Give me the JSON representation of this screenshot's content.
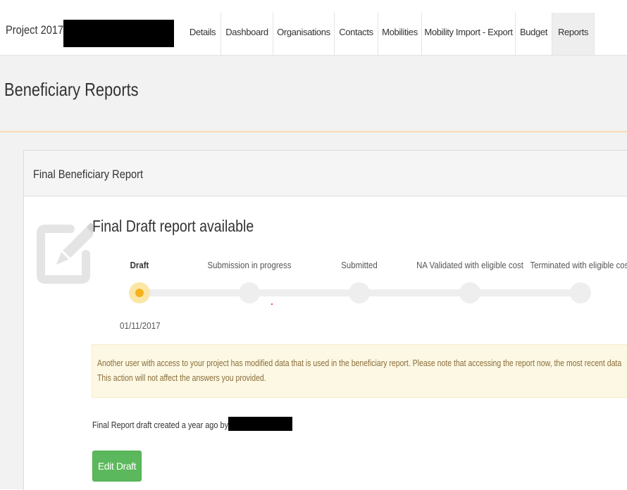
{
  "nav": {
    "project_title": "Project 2017",
    "tabs": [
      {
        "label": "Details"
      },
      {
        "label": "Dashboard"
      },
      {
        "label": "Organisations"
      },
      {
        "label": "Contacts"
      },
      {
        "label": "Mobilities"
      },
      {
        "label": "Mobility Import - Export"
      },
      {
        "label": "Budget"
      },
      {
        "label": "Reports",
        "active": true
      }
    ]
  },
  "page": {
    "title": "Beneficiary Reports"
  },
  "panel": {
    "title": "Final Beneficiary Report",
    "icon": "pencil-square-icon",
    "status_title": "Final Draft report available",
    "steps": [
      {
        "label": "Draft",
        "active": true,
        "date": "01/11/2017"
      },
      {
        "label": "Submission in progress"
      },
      {
        "label": "Submitted"
      },
      {
        "label": "NA Validated with eligible cost"
      },
      {
        "label": "Terminated with eligible cost"
      }
    ],
    "alert": {
      "line1": "Another user with access to your project has modified data that is used in the beneficiary report. Please note that accessing the report now, the most recent data",
      "line2": "This action will not affect the answers you provided."
    },
    "created_text": "Final Report draft created a year ago by S",
    "edit_button": "Edit Draft"
  },
  "colors": {
    "active_tab_bg": "#eeeeee",
    "header_bg": "#f2f2f2",
    "header_border": "#f6dcb0",
    "step_active": "#f5b21a",
    "step_active_ring": "#fbe6a6",
    "alert_bg": "#fcf8e3",
    "alert_text": "#8a6d3b",
    "button_green": "#5cb85c"
  }
}
